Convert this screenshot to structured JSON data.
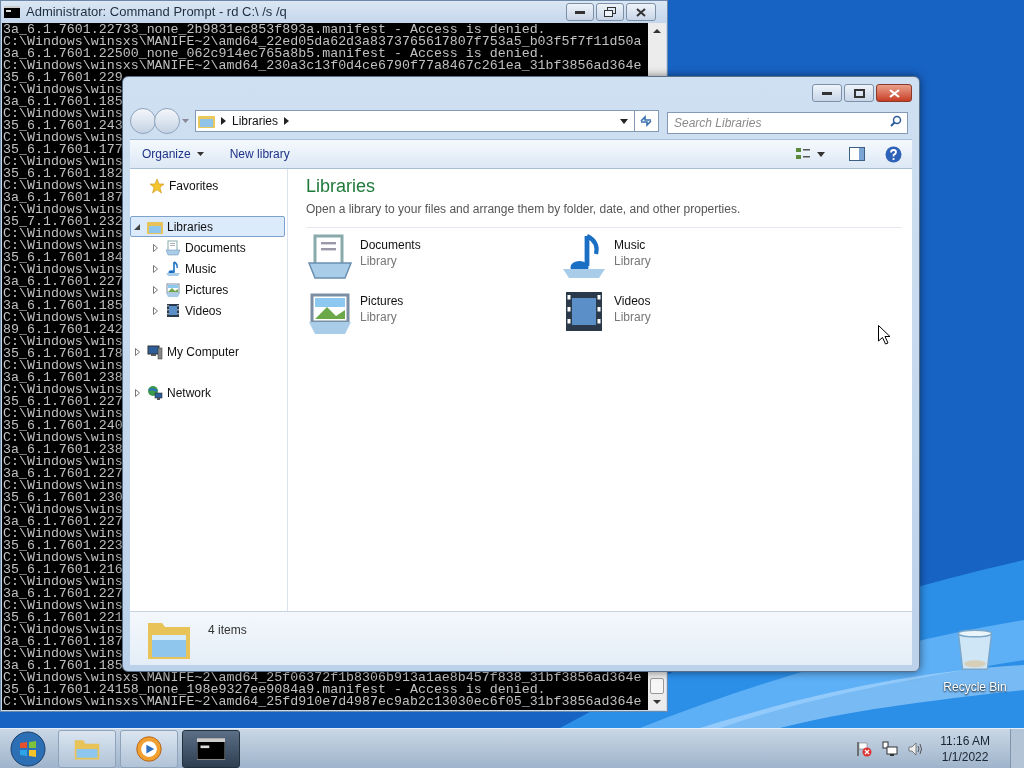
{
  "console": {
    "title": "Administrator: Command Prompt - rd  C:\\ /s /q",
    "lines": [
      "3a_6.1.7601.22733_none_2b9831ec853f893a.manifest - Access is denied.",
      "C:\\Windows\\winsxs\\MANIFE~2\\amd64_22ed05da62d3a8373765617807f753a5_b03f5f7f11d50a",
      "3a_6.1.7601.22500_none_062c914ec765a8b5.manifest - Access is denied.",
      "C:\\Windows\\winsxs\\MANIFE~2\\amd64_230a3c13f0d4ce6790f77a8467c261ea_31bf3856ad364e",
      "35_6.1.7601.229",
      "C:\\Windows\\wins",
      "3a_6.1.7601.185",
      "C:\\Windows\\wins",
      "35_6.1.7601.243",
      "C:\\Windows\\wins",
      "35_6.1.7601.177",
      "C:\\Windows\\wins",
      "35_6.1.7601.182",
      "C:\\Windows\\wins",
      "3a_6.1.7601.187",
      "C:\\Windows\\wins",
      "35_7.1.7601.232",
      "C:\\Windows\\wins",
      "C:\\Windows\\wins",
      "35_6.1.7601.184",
      "C:\\Windows\\wins",
      "3a_6.1.7601.227",
      "C:\\Windows\\wins",
      "3a_6.1.7601.185",
      "C:\\Windows\\wins",
      "89_6.1.7601.242",
      "C:\\Windows\\wins",
      "35_6.1.7601.178",
      "C:\\Windows\\wins",
      "3a_6.1.7601.238",
      "C:\\Windows\\wins",
      "35_6.1.7601.227",
      "C:\\Windows\\wins",
      "35_6.1.7601.240",
      "C:\\Windows\\wins",
      "3a_6.1.7601.238",
      "C:\\Windows\\wins",
      "3a_6.1.7601.227",
      "C:\\Windows\\wins",
      "35_6.1.7601.230",
      "C:\\Windows\\wins",
      "3a_6.1.7601.227",
      "C:\\Windows\\wins",
      "35_6.1.7601.223",
      "C:\\Windows\\wins",
      "35_6.1.7601.216",
      "C:\\Windows\\wins",
      "3a_6.1.7601.227",
      "C:\\Windows\\wins",
      "35_6.1.7601.221",
      "C:\\Windows\\wins",
      "3a_6.1.7601.187",
      "C:\\Windows\\wins",
      "3a_6.1.7601.185",
      "C:\\Windows\\winsxs\\MANIFE~2\\amd64_25f06372f1b8306b913a1ae8b457f838_31bf3856ad364e",
      "35_6.1.7601.24158_none_198e9327ee9084a9.manifest - Access is denied.",
      "C:\\Windows\\winsxs\\MANIFE~2\\amd64_25fd910e7d4987ec9ab2c13030ec6f05_31bf3856ad364e"
    ]
  },
  "explorer": {
    "address": [
      "Libraries"
    ],
    "search": {
      "placeholder": "Search Libraries"
    },
    "toolbar": [
      "Organize",
      "New library"
    ],
    "nav": [
      {
        "label": "Favorites",
        "kind": "star",
        "selected": false
      },
      {
        "label": "Libraries",
        "kind": "library",
        "selected": true,
        "expanded": true,
        "children": [
          {
            "label": "Documents",
            "kind": "documents",
            "selected": false,
            "expanded": false
          },
          {
            "label": "Music",
            "kind": "music",
            "selected": false,
            "expanded": false
          },
          {
            "label": "Pictures",
            "kind": "pictures",
            "selected": false,
            "expanded": false
          },
          {
            "label": "Videos",
            "kind": "videos",
            "selected": false,
            "expanded": false
          }
        ]
      },
      {
        "label": "My Computer",
        "kind": "computer",
        "selected": false,
        "expanded": false
      },
      {
        "label": "Network",
        "kind": "network",
        "selected": false,
        "expanded": false
      }
    ],
    "heading": "Libraries",
    "description": "Open a library to your files and arrange them by folder, date, and other properties.",
    "items": [
      {
        "name": "Documents",
        "type": "Library",
        "kind": "documents"
      },
      {
        "name": "Music",
        "type": "Library",
        "kind": "music"
      },
      {
        "name": "Pictures",
        "type": "Library",
        "kind": "pictures"
      },
      {
        "name": "Videos",
        "type": "Library",
        "kind": "videos"
      }
    ],
    "details": "4 items"
  },
  "desktop_icons": [
    {
      "label": "Recycle Bin",
      "kind": "recycle"
    }
  ],
  "taskbar": {
    "apps": [
      {
        "kind": "explorer",
        "selected": false
      },
      {
        "kind": "media",
        "selected": false
      },
      {
        "kind": "console",
        "selected": true
      }
    ],
    "time": "11:16 AM",
    "date": "1/1/2022"
  }
}
